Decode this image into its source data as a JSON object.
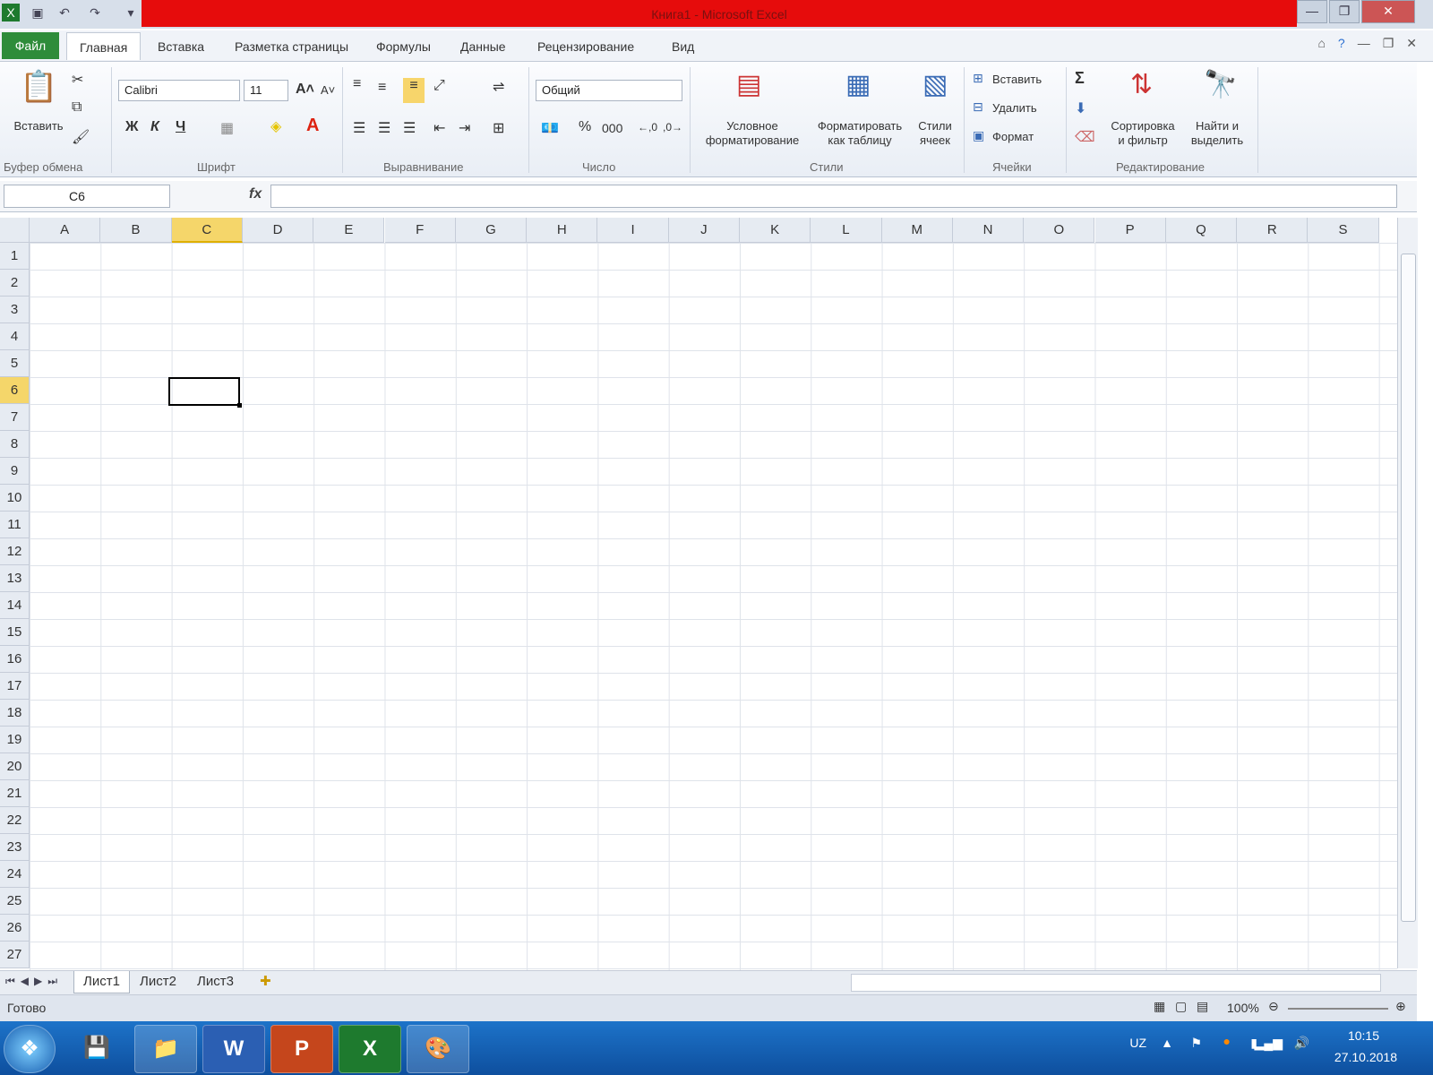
{
  "window": {
    "title": "Книга1 - Microsoft Excel",
    "min": "—",
    "max": "❐",
    "close": "✕"
  },
  "menu": {
    "file": "Файл",
    "tabs": [
      "Главная",
      "Вставка",
      "Разметка страницы",
      "Формулы",
      "Данные",
      "Рецензирование",
      "Вид"
    ]
  },
  "ribbon": {
    "paste": "Вставить",
    "clipboard_group": "Буфер обмена",
    "font_name": "Calibri",
    "font_size": "11",
    "bold": "Ж",
    "italic": "К",
    "underline": "Ч",
    "font_group": "Шрифт",
    "align_group": "Выравнивание",
    "number_format": "Общий",
    "percent": "%",
    "thousands": "000",
    "number_group": "Число",
    "conditional_line1": "Условное",
    "conditional_line2": "форматирование",
    "format_table_line1": "Форматировать",
    "format_table_line2": "как таблицу",
    "cell_styles_line1": "Стили",
    "cell_styles_line2": "ячеек",
    "styles_group": "Стили",
    "insert_cells": "Вставить",
    "delete_cells": "Удалить",
    "format_cells": "Формат",
    "cells_group": "Ячейки",
    "sort_line1": "Сортировка",
    "sort_line2": "и фильтр",
    "find_line1": "Найти и",
    "find_line2": "выделить",
    "editing_group": "Редактирование"
  },
  "formula_bar": {
    "name_box": "C6",
    "fx": "fx",
    "value": ""
  },
  "sheet": {
    "columns": [
      "A",
      "B",
      "C",
      "D",
      "E",
      "F",
      "G",
      "H",
      "I",
      "J",
      "K",
      "L",
      "M",
      "N",
      "O",
      "P",
      "Q",
      "R",
      "S"
    ],
    "rows": [
      "1",
      "2",
      "3",
      "4",
      "5",
      "6",
      "7",
      "8",
      "9",
      "10",
      "11",
      "12",
      "13",
      "14",
      "15",
      "16",
      "17",
      "18",
      "19",
      "20",
      "21",
      "22",
      "23",
      "24",
      "25",
      "26",
      "27"
    ],
    "selected_column": "C",
    "selected_row": "6"
  },
  "sheet_tabs": [
    "Лист1",
    "Лист2",
    "Лист3"
  ],
  "status": {
    "ready": "Готово",
    "zoom": "100%"
  },
  "taskbar": {
    "language": "UZ",
    "time": "10:15",
    "date": "27.10.2018"
  }
}
